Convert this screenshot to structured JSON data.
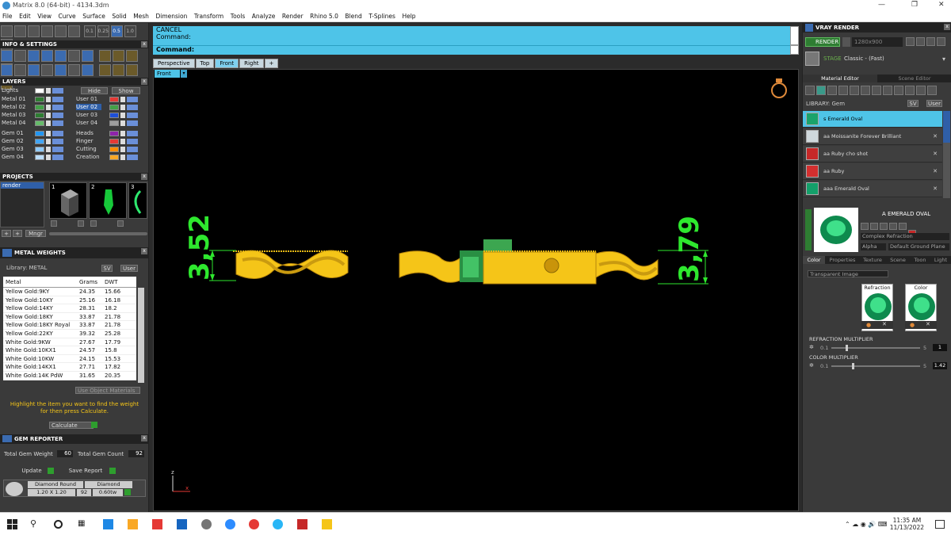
{
  "window": {
    "title": "Matrix 8.0 (64-bit) - 4134.3dm",
    "minimize": "—",
    "restore": "❐",
    "close": "✕"
  },
  "menu": [
    "File",
    "Edit",
    "View",
    "Curve",
    "Surface",
    "Solid",
    "Mesh",
    "Dimension",
    "Transform",
    "Tools",
    "Analyze",
    "Render",
    "Rhino 5.0",
    "Blend",
    "T-Splines",
    "Help"
  ],
  "toolbar": {
    "value1": "0.1",
    "value2": "0.25",
    "value3": "0.5",
    "value4": "1.0"
  },
  "info_settings": {
    "title": "INFO & SETTINGS"
  },
  "layers": {
    "title": "LAYERS",
    "lights_label": "Lights",
    "hide_label": "Hide",
    "show_label": "Show",
    "left": [
      {
        "name": "Metal 01",
        "color": "#2e7d32"
      },
      {
        "name": "Metal 02",
        "color": "#43a047"
      },
      {
        "name": "Metal 03",
        "color": "#2e7d32"
      },
      {
        "name": "Metal 04",
        "color": "#66bb6a"
      },
      {
        "name": "Gem 01",
        "color": "#2196f3"
      },
      {
        "name": "Gem 02",
        "color": "#42a5f5"
      },
      {
        "name": "Gem 03",
        "color": "#90caf9"
      },
      {
        "name": "Gem 04",
        "color": "#bbdefb"
      }
    ],
    "right": [
      {
        "name": "User 01",
        "color": "#e53935"
      },
      {
        "name": "User 02",
        "color": "#43a047",
        "selected": true
      },
      {
        "name": "User 03",
        "color": "#1e4fd8"
      },
      {
        "name": "User 04",
        "color": "#9e9e9e"
      },
      {
        "name": "Heads",
        "color": "#8e24aa"
      },
      {
        "name": "Finger",
        "color": "#e53935"
      },
      {
        "name": "Cutting",
        "color": "#fb8c00"
      },
      {
        "name": "Creation",
        "color": "#f9a825"
      }
    ]
  },
  "projects": {
    "title": "PROJECTS",
    "item": "render",
    "thumbs": [
      "1",
      "2",
      "3"
    ],
    "manager": "Mngr"
  },
  "metal_weights": {
    "title": "METAL WEIGHTS",
    "library_label": "Library: METAL",
    "sv": "SV",
    "user": "User",
    "headers": [
      "Metal",
      "Grams",
      "DWT"
    ],
    "rows": [
      [
        "Yellow Gold:9KY",
        "24.35",
        "15.66"
      ],
      [
        "Yellow Gold:10KY",
        "25.16",
        "16.18"
      ],
      [
        "Yellow Gold:14KY",
        "28.31",
        "18.2"
      ],
      [
        "Yellow Gold:18KY",
        "33.87",
        "21.78"
      ],
      [
        "Yellow Gold:18KY Royal",
        "33.87",
        "21.78"
      ],
      [
        "Yellow Gold:22KY",
        "39.32",
        "25.28"
      ],
      [
        "White Gold:9KW",
        "27.67",
        "17.79"
      ],
      [
        "White Gold:10KX1",
        "24.57",
        "15.8"
      ],
      [
        "White Gold:10KW",
        "24.15",
        "15.53"
      ],
      [
        "White Gold:14KX1",
        "27.71",
        "17.82"
      ],
      [
        "White Gold:14K PdW",
        "31.65",
        "20.35"
      ]
    ],
    "use_object": "Use Object Materials",
    "hint": "Highlight the item you want to find the weight for then press Calculate.",
    "calculate": "Calculate"
  },
  "gem_reporter": {
    "title": "GEM REPORTER",
    "total_weight_label": "Total Gem Weight",
    "total_weight": "60",
    "total_count_label": "Total Gem Count",
    "total_count": "92",
    "update": "Update",
    "save_report": "Save Report",
    "col1": "Diamond Round",
    "col2": "Diamond",
    "size": "1.20 X 1.20",
    "count": "92",
    "carat": "0.60tw"
  },
  "command": {
    "line1": "CANCEL",
    "line2": "Command:",
    "prompt": "Command:"
  },
  "viewport": {
    "tabs": [
      "Perspective",
      "Top",
      "Front",
      "Right",
      "+"
    ],
    "active_tab": "Front",
    "label": "Front",
    "dim_left": "3,52",
    "dim_right": "3,79",
    "gold": "#f5c518",
    "dim_color": "#2ee82e"
  },
  "vray": {
    "title": "VRAY RENDER",
    "render_btn": "RENDER",
    "resolution": "1280x900",
    "preset_label": "STAGE",
    "preset": "Classic - (Fast)",
    "tab_material": "Material Editor",
    "tab_scene": "Scene Editor",
    "library_label": "LIBRARY: Gem",
    "sv": "SV",
    "user": "User",
    "materials": [
      {
        "name": "s Emerald Oval",
        "color": "#1aa36b",
        "selected": true
      },
      {
        "name": "aa Moissanite Forever Brilliant",
        "color": "#cfd8dc"
      },
      {
        "name": "aa Ruby cho shot",
        "color": "#c62828"
      },
      {
        "name": "aa Ruby",
        "color": "#d32f2f"
      },
      {
        "name": "aaa Emerald Oval",
        "color": "#14a06a"
      }
    ],
    "preview_name": "A EMERALD OVAL",
    "option1": "Complex Refraction",
    "option2": "Alpha",
    "option3": "Default Ground Plane",
    "subtabs": [
      "Color",
      "Properties",
      "Texture",
      "Scene",
      "Toon",
      "Light"
    ],
    "transparent": "Transparent Image",
    "refraction": "Refraction",
    "color": "Color",
    "refraction_multiplier": "REFRACTION MULTIPLIER",
    "refraction_min": "0.1",
    "refraction_max": "5",
    "refraction_value": "1",
    "color_multiplier": "COLOR MULTIPLIER",
    "color_min": "0.1",
    "color_max": "5",
    "color_value": "1.42"
  },
  "taskbar": {
    "time": "11:35 AM",
    "date": "11/13/2022",
    "apps": [
      {
        "name": "edge",
        "color": "#1e88e5"
      },
      {
        "name": "explorer",
        "color": "#f9a825"
      },
      {
        "name": "store",
        "color": "#e53935"
      },
      {
        "name": "mail",
        "color": "#1565c0"
      },
      {
        "name": "app1",
        "color": "#757575"
      },
      {
        "name": "zoom",
        "color": "#2d8cff"
      },
      {
        "name": "chrome",
        "color": "#e53935"
      },
      {
        "name": "app2",
        "color": "#29b6f6"
      },
      {
        "name": "app3",
        "color": "#c62828"
      },
      {
        "name": "app4",
        "color": "#f5c518"
      }
    ]
  }
}
